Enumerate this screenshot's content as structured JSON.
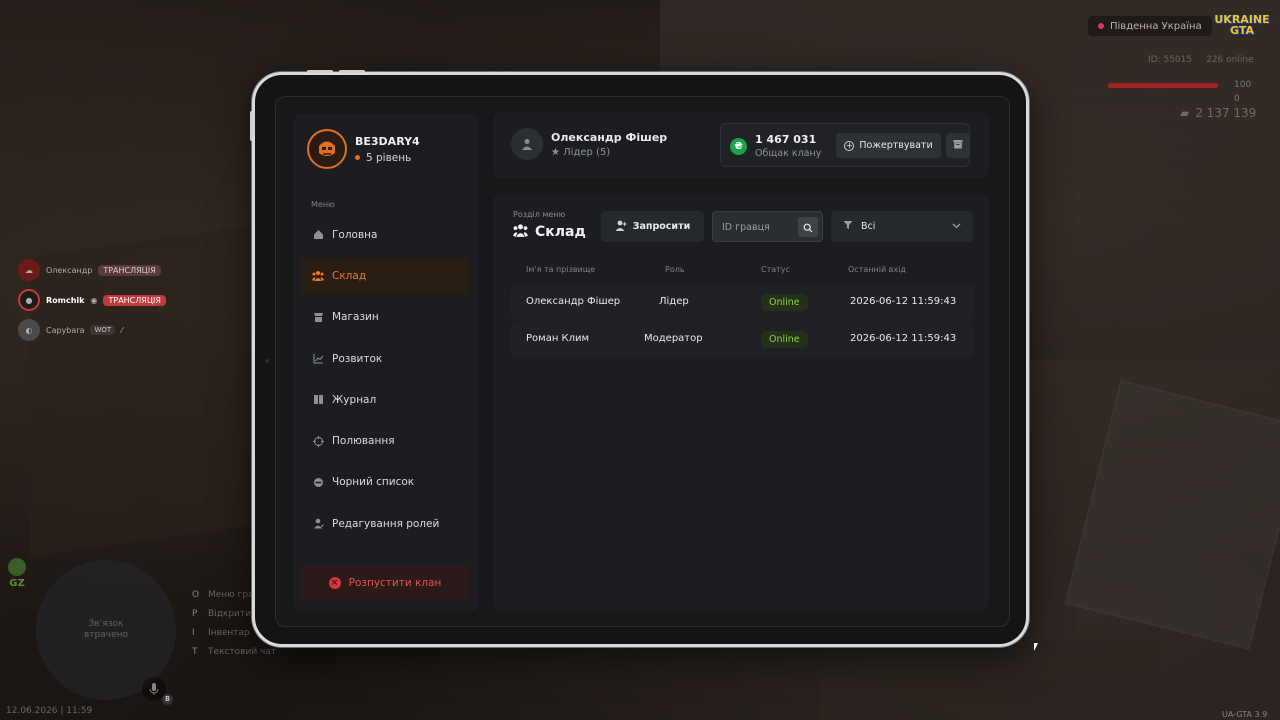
{
  "hud": {
    "region": "Південна Україна",
    "logo_line1": "UKRAINE",
    "logo_line2": "GTA",
    "id_text": "ID: 55015",
    "online_text": "226 online",
    "health": 100,
    "armor": 0,
    "money": "2 137 139",
    "datetime": "12.06.2026 | 11:59",
    "version": "UA-GTA 3.9",
    "minimap_text": "Зв'язок втрачено",
    "gz_label": "GZ",
    "mic_badge": "B"
  },
  "voice": [
    {
      "name": "Олександр",
      "tag": "ТРАНСЛЯЦІЯ",
      "sub": ""
    },
    {
      "name": "Romchik",
      "tag": "ТРАНСЛЯЦІЯ",
      "sub": ""
    },
    {
      "name": "Capybara",
      "tag": "",
      "sub": "WOT"
    }
  ],
  "hotkeys": [
    {
      "key": "O",
      "label": "Меню гра"
    },
    {
      "key": "P",
      "label": "Відкрити"
    },
    {
      "key": "I",
      "label": "Інвентар"
    },
    {
      "key": "T",
      "label": "Текстовий чат"
    }
  ],
  "profile": {
    "name": "BE3DARY4",
    "level": "5 рівень"
  },
  "menu": {
    "label": "Меню",
    "items": [
      {
        "label": "Головна",
        "icon": "home-icon",
        "active": false
      },
      {
        "label": "Склад",
        "icon": "people-icon",
        "active": true
      },
      {
        "label": "Магазин",
        "icon": "shop-icon",
        "active": false
      },
      {
        "label": "Розвиток",
        "icon": "chart-icon",
        "active": false
      },
      {
        "label": "Журнал",
        "icon": "book-icon",
        "active": false
      },
      {
        "label": "Полювання",
        "icon": "crosshair-icon",
        "active": false
      },
      {
        "label": "Чорний список",
        "icon": "ban-icon",
        "active": false
      },
      {
        "label": "Редагування ролей",
        "icon": "user-edit-icon",
        "active": false
      }
    ],
    "dissolve": "Розпустити клан"
  },
  "leader": {
    "name": "Олександр Фішер",
    "role": "Лідер (5)"
  },
  "bank": {
    "amount": "1 467 031",
    "label": "Общак клану",
    "donate": "Пожертвувати"
  },
  "section": {
    "label": "Розділ меню",
    "title": "Склад",
    "invite": "Запросити",
    "search_placeholder": "ID гравця",
    "filter": "Всі"
  },
  "table": {
    "headers": [
      "Ім'я та прізвище",
      "Роль",
      "Статус",
      "Останній вхід"
    ],
    "rows": [
      {
        "name": "Олександр Фішер",
        "role": "Лідер",
        "status": "Online",
        "last": "2026-06-12 11:59:43"
      },
      {
        "name": "Роман Клим",
        "role": "Модератор",
        "status": "Online",
        "last": "2026-06-12 11:59:43"
      }
    ]
  }
}
